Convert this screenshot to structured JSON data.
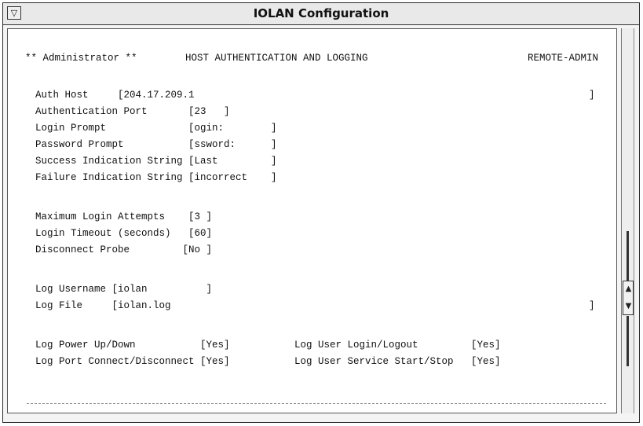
{
  "window": {
    "title": "IOLAN Configuration",
    "menu_glyph": "▽"
  },
  "header": {
    "user": "** Administrator **",
    "section": "HOST AUTHENTICATION AND LOGGING",
    "mode": "REMOTE-ADMIN"
  },
  "fields": {
    "auth_host": "Auth Host     [204.17.209.1",
    "auth_host_close": "]",
    "auth_port": "Authentication Port       [23   ]",
    "login_prompt": "Login Prompt              [ogin:        ]",
    "password_prompt": "Password Prompt           [ssword:      ]",
    "success_string": "Success Indication String [Last         ]",
    "failure_string": "Failure Indication String [incorrect    ]",
    "max_attempts": "Maximum Login Attempts    [3 ]",
    "login_timeout": "Login Timeout (seconds)   [60]",
    "disconnect_probe": "Disconnect Probe         [No ]",
    "log_username": "Log Username [iolan          ]",
    "log_file": "Log File     [iolan.log",
    "log_file_close": "]",
    "log_power": "Log Power Up/Down           [Yes]",
    "log_port": "Log Port Connect/Disconnect [Yes]",
    "log_user_login": "Log User Login/Logout         [Yes]",
    "log_user_service": "Log User Service Start/Stop   [Yes]"
  },
  "scrollbar": {
    "up_glyph": "▲",
    "down_glyph": "▼"
  }
}
